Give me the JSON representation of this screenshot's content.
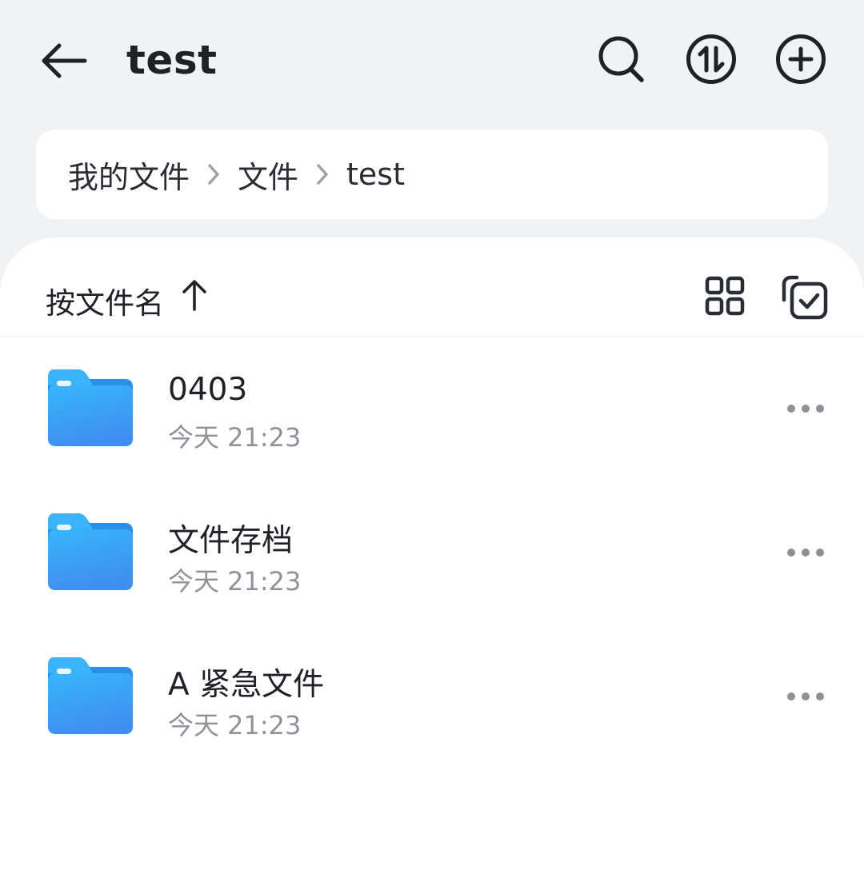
{
  "header": {
    "title": "test",
    "back_icon": "arrow-left-icon",
    "actions": [
      "search-icon",
      "sort-swap-icon",
      "add-circle-icon"
    ]
  },
  "breadcrumb": {
    "items": [
      "我的文件",
      "文件",
      "test"
    ]
  },
  "sort": {
    "label": "按文件名",
    "direction_icon": "arrow-up-icon",
    "view_icon": "grid-view-icon",
    "select_icon": "multi-select-icon"
  },
  "files": [
    {
      "name": "0403",
      "time": "今天 21:23",
      "type": "folder"
    },
    {
      "name": "文件存档",
      "time": "今天 21:23",
      "type": "folder"
    },
    {
      "name": "A 紧急文件",
      "time": "今天 21:23",
      "type": "folder"
    }
  ],
  "colors": {
    "background": "#f1f2f4",
    "surface": "#ffffff",
    "text_primary": "#1f2126",
    "text_secondary": "#8f9399",
    "folder_blue": "#3d9bf5"
  }
}
